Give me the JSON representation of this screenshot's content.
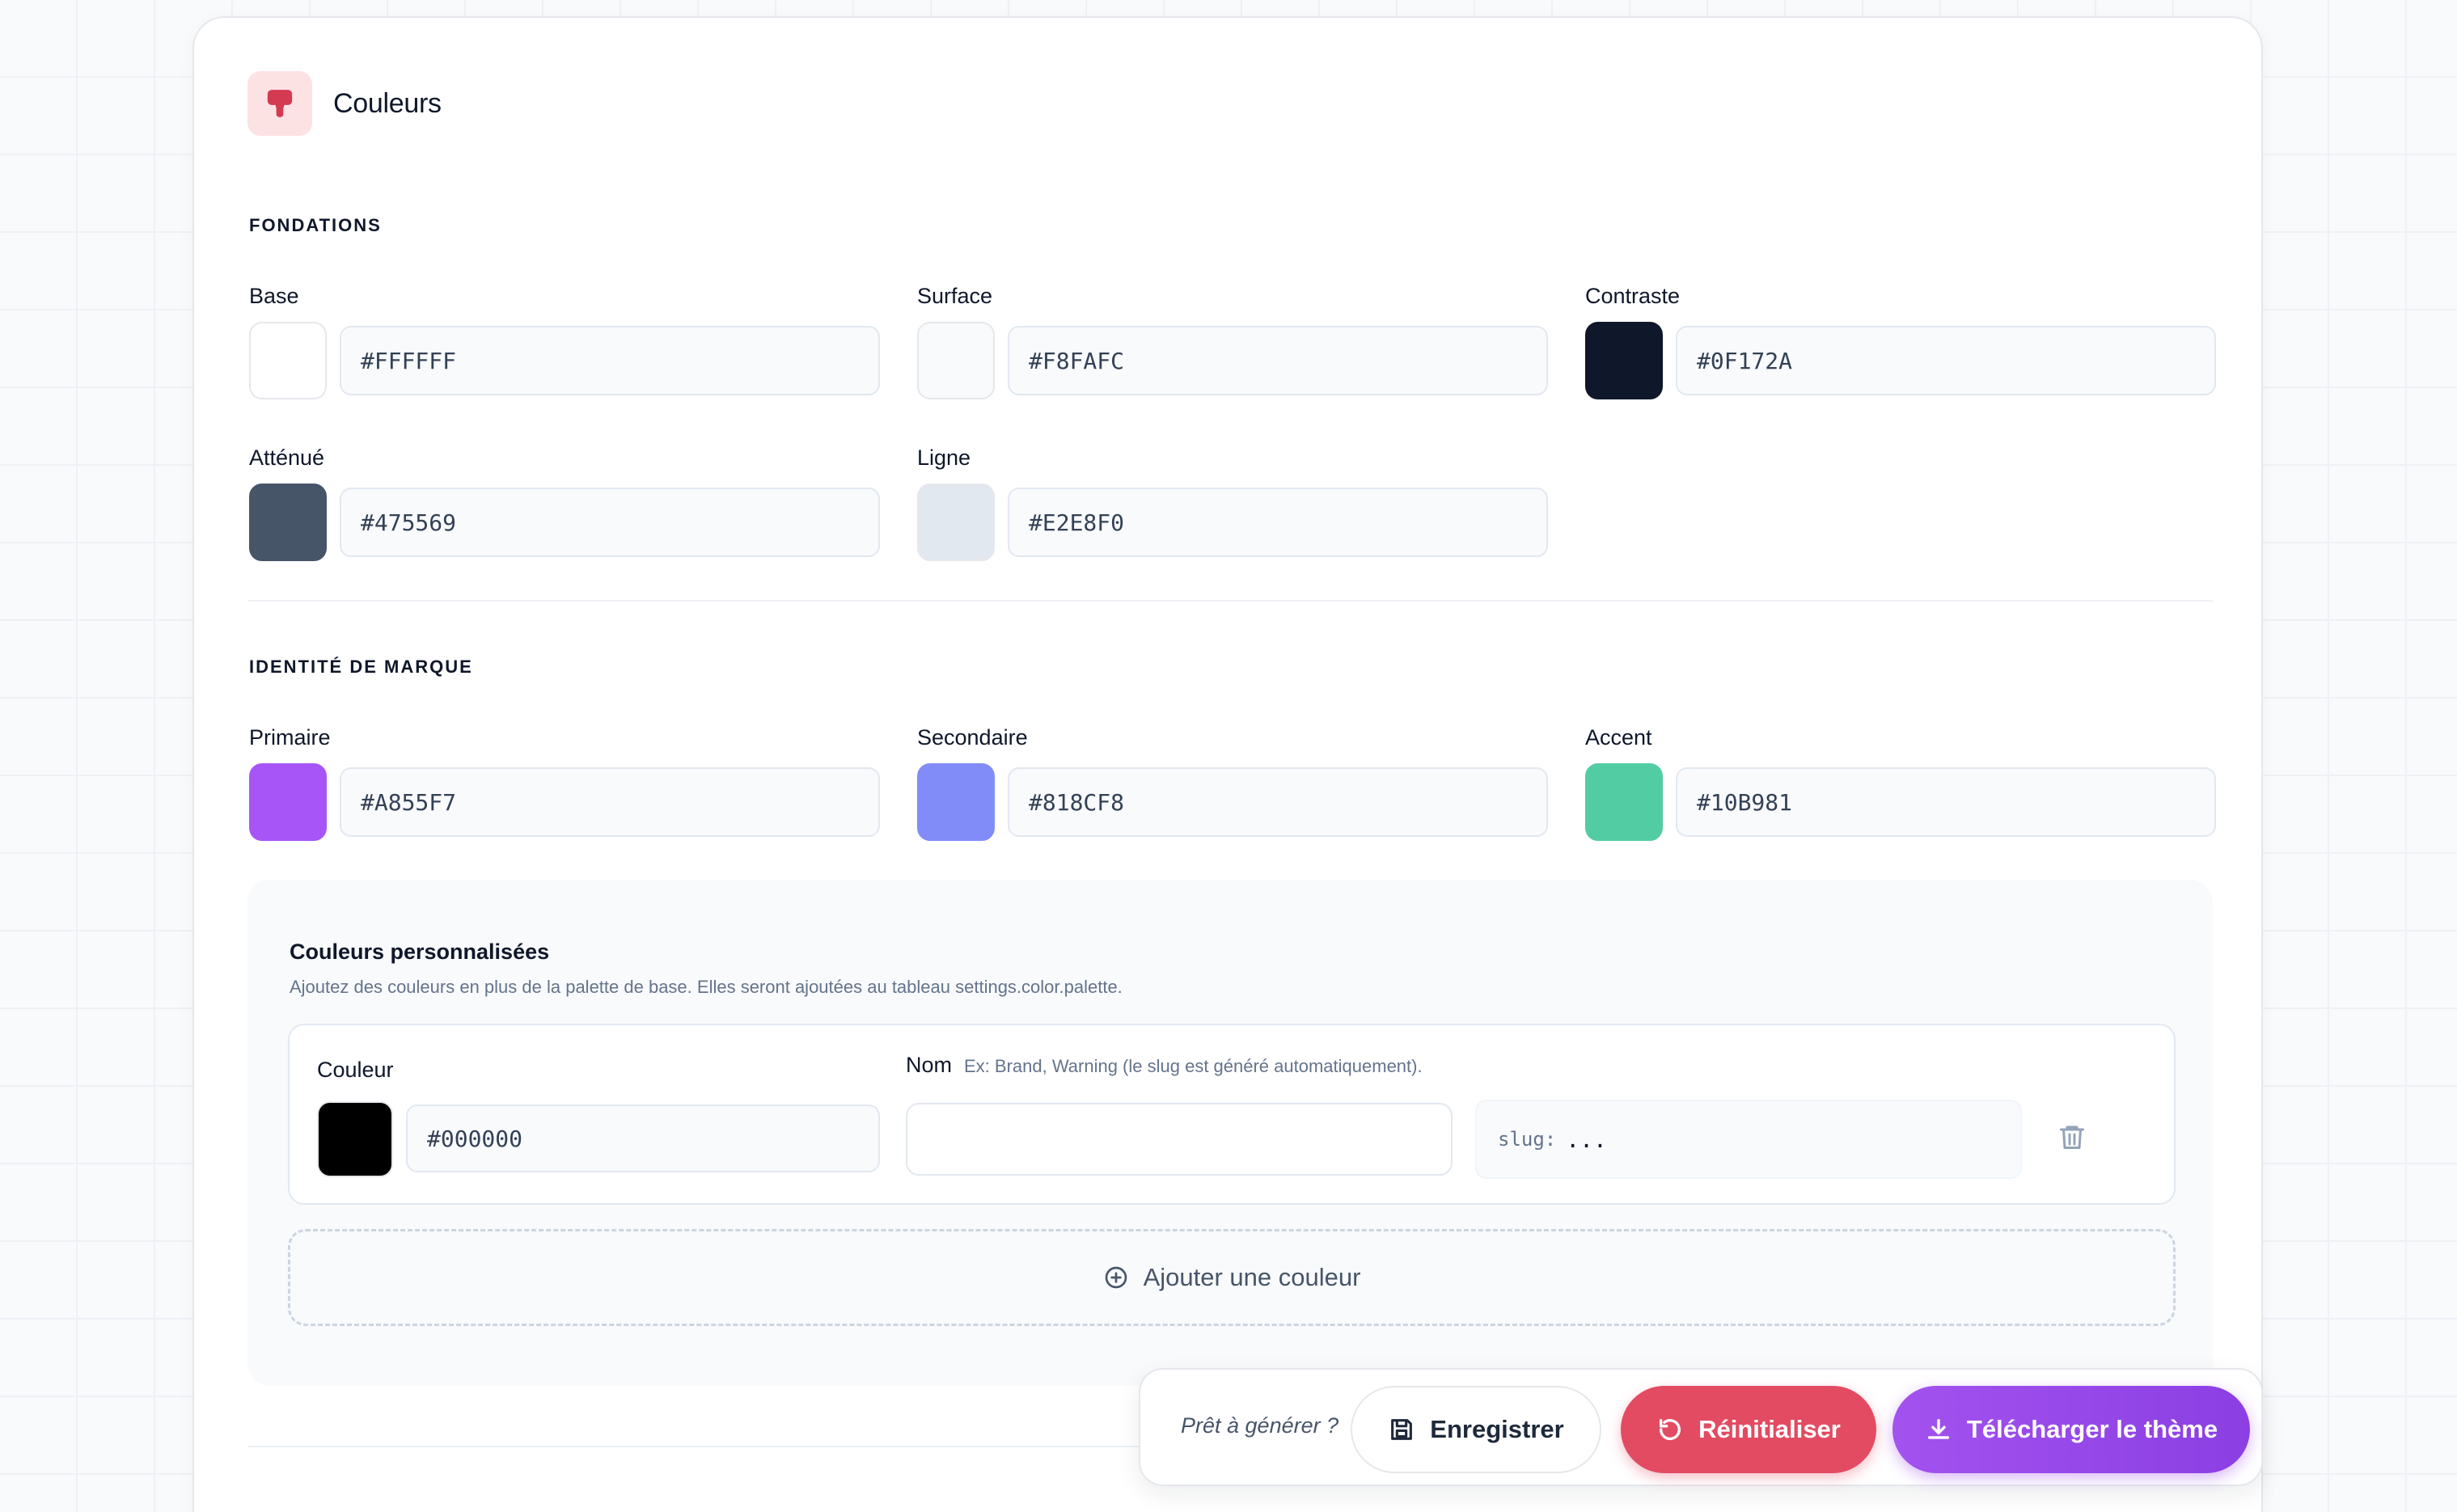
{
  "header": {
    "title": "Couleurs",
    "icon": "paint-roller-icon",
    "icon_color": "#d43a52"
  },
  "fondations": {
    "title": "FONDATIONS",
    "fields": [
      {
        "label": "Base",
        "value": "#FFFFFF",
        "swatch": "#FFFFFF"
      },
      {
        "label": "Surface",
        "value": "#F8FAFC",
        "swatch": "#F8FAFC"
      },
      {
        "label": "Contraste",
        "value": "#0F172A",
        "swatch": "#0F172A"
      },
      {
        "label": "Atténué",
        "value": "#475569",
        "swatch": "#475569"
      },
      {
        "label": "Ligne",
        "value": "#E2E8F0",
        "swatch": "#E2E8F0"
      }
    ]
  },
  "identite": {
    "title": "IDENTITÉ DE MARQUE",
    "fields": [
      {
        "label": "Primaire",
        "value": "#A855F7",
        "swatch": "#A855F7"
      },
      {
        "label": "Secondaire",
        "value": "#818CF8",
        "swatch": "#818CF8"
      },
      {
        "label": "Accent",
        "value": "#10B981",
        "swatch": "#10B981"
      }
    ]
  },
  "custom": {
    "title": "Couleurs personnalisées",
    "description": "Ajoutez des couleurs en plus de la palette de base. Elles seront ajoutées au tableau settings.color.palette.",
    "row": {
      "color_label": "Couleur",
      "color_value": "#000000",
      "swatch": "#000000",
      "name_label": "Nom",
      "name_hint": "Ex: Brand, Warning (le slug est généré automatiquement).",
      "name_value": "",
      "slug_prefix": "slug:",
      "slug_value": "..."
    },
    "add_label": "Ajouter une couleur"
  },
  "actions": {
    "ready_text": "Prêt à générer ?",
    "save_label": "Enregistrer",
    "reset_label": "Réinitialiser",
    "download_label": "Télécharger le thème",
    "reset_color": "#E24B62",
    "download_color": "#9B4AEB"
  }
}
